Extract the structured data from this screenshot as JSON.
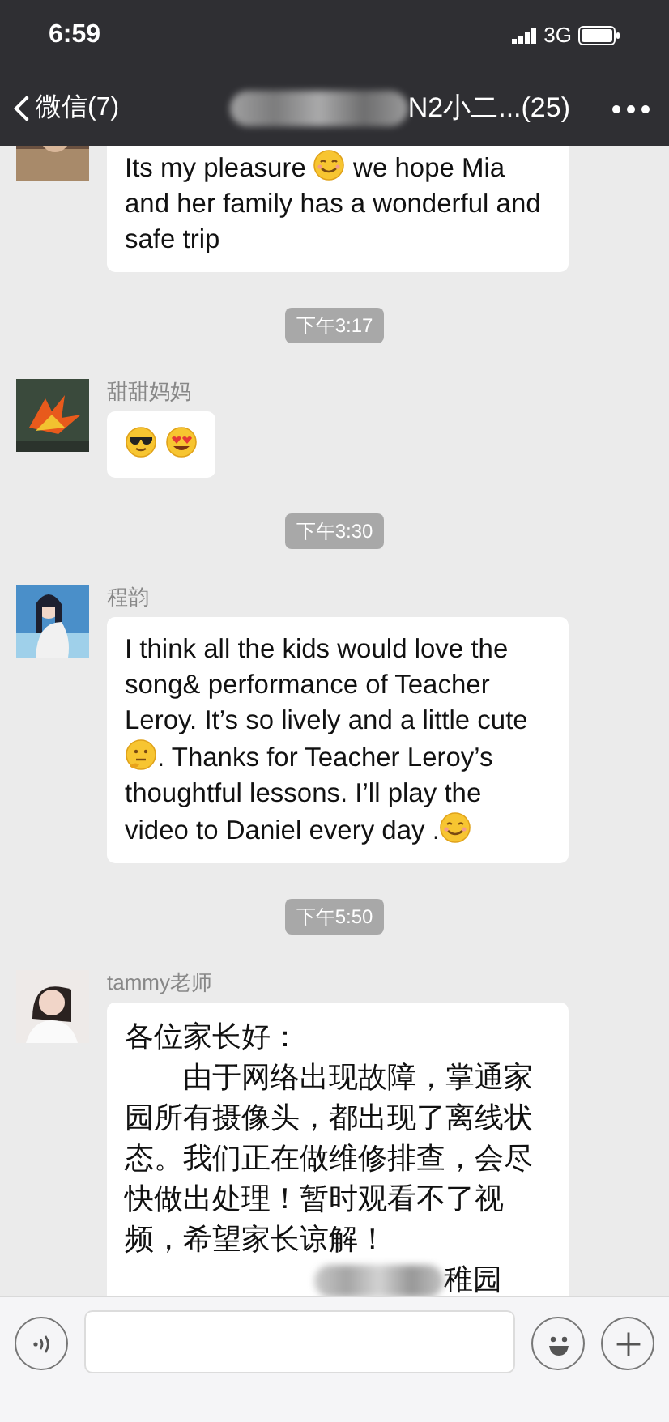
{
  "status_bar": {
    "time": "6:59",
    "network": "3G"
  },
  "nav": {
    "back_label": "微信(7)",
    "title": "N2小二...(25)",
    "title_redacted": true
  },
  "messages": [
    {
      "kind": "message",
      "parts": [
        {
          "kind": "text",
          "text": "Its my pleasure "
        },
        {
          "kind": "emoji-smile"
        },
        {
          "kind": "text",
          "text": " we hope Mia and her family has a wonderful and safe trip"
        }
      ]
    },
    {
      "kind": "time",
      "text": "下午3:17"
    },
    {
      "kind": "message",
      "sender": "甜甜妈妈",
      "parts": [
        {
          "kind": "emoji-sunglasses"
        },
        {
          "kind": "emoji-heart-eyes"
        }
      ]
    },
    {
      "kind": "time",
      "text": "下午3:30"
    },
    {
      "kind": "message",
      "sender": "程韵",
      "parts": [
        {
          "kind": "text",
          "text": "I think all the kids would love the song& performance of Teacher Leroy. It’s so lively and a little cute"
        },
        {
          "kind": "emoji-thinking"
        },
        {
          "kind": "text",
          "text": ". Thanks for Teacher Leroy’s thoughtful lessons. I’ll play the video to Daniel every day ."
        },
        {
          "kind": "emoji-smile"
        }
      ]
    },
    {
      "kind": "time",
      "text": "下午5:50"
    },
    {
      "kind": "message",
      "sender": "tammy老师",
      "cjk": true,
      "parts": [
        {
          "kind": "text",
          "text": "各位家长好："
        },
        {
          "kind": "break"
        },
        {
          "kind": "text",
          "text": "　　由于网络出现故障，掌通家园所有摄像头，都出现了离线状态。我们正在做维修排查，会尽快做出处理！暂时观看不了视频，希望家长谅解！"
        }
      ],
      "signature": "稚园",
      "signature_redacted": true
    }
  ]
}
